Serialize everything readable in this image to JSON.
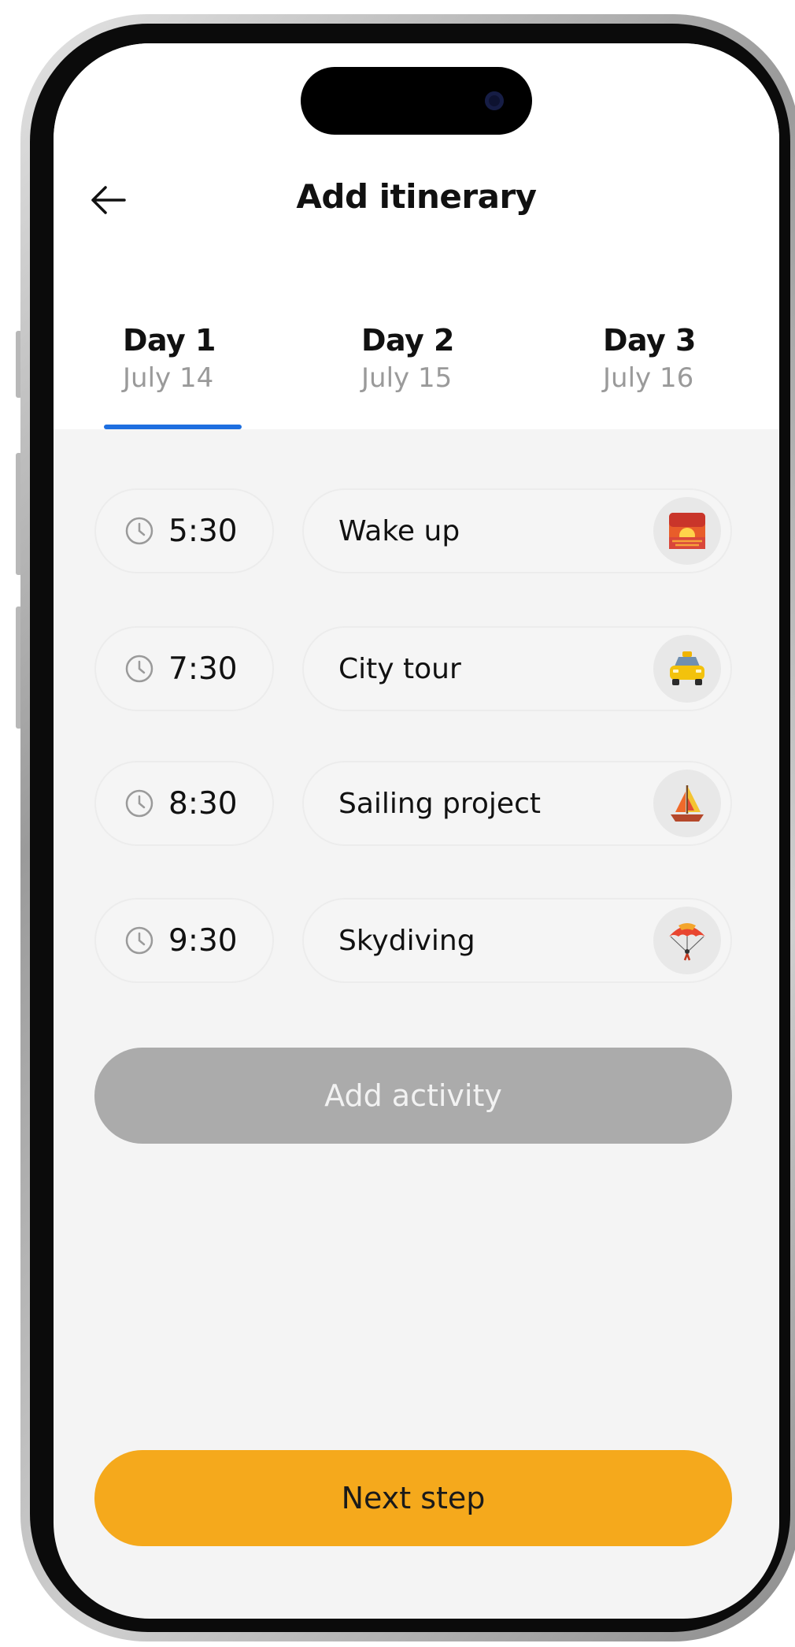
{
  "header": {
    "title": "Add itinerary",
    "back_icon": "arrow-left-icon"
  },
  "tabs": [
    {
      "label": "Day 1",
      "date": "July 14",
      "active": true
    },
    {
      "label": "Day 2",
      "date": "July 15",
      "active": false
    },
    {
      "label": "Day 3",
      "date": "July 16",
      "active": false
    }
  ],
  "activities": [
    {
      "time": "5:30",
      "name": "Wake up",
      "icon": "sunrise-icon"
    },
    {
      "time": "7:30",
      "name": "City tour",
      "icon": "taxi-icon"
    },
    {
      "time": "8:30",
      "name": "Sailing project",
      "icon": "sailboat-icon"
    },
    {
      "time": "9:30",
      "name": "Skydiving",
      "icon": "parachute-icon"
    }
  ],
  "buttons": {
    "add_activity": "Add activity",
    "next_step": "Next step"
  },
  "colors": {
    "accent": "#f5a91c",
    "tab_indicator": "#1e6fe0",
    "disabled": "#ababab"
  }
}
